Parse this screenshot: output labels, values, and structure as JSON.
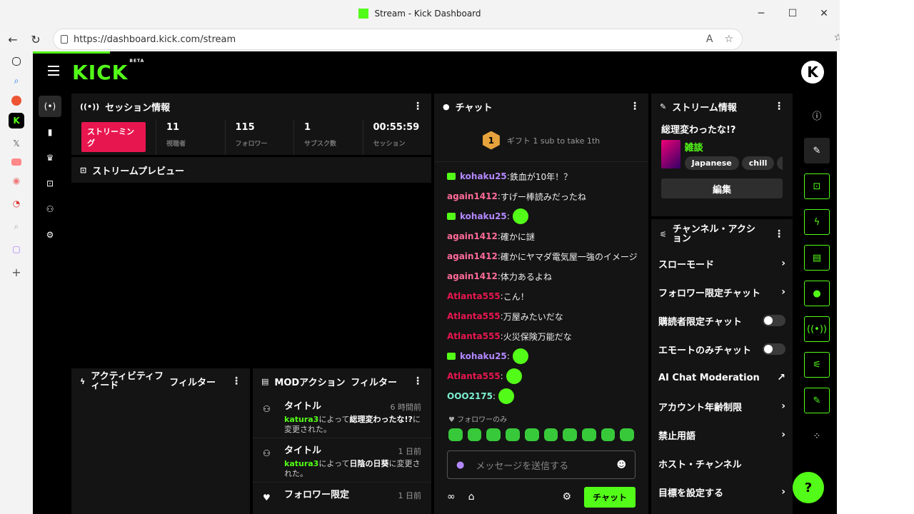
{
  "browser": {
    "title": "Stream - Kick Dashboard",
    "url": "https://dashboard.kick.com/stream",
    "minimize": "─",
    "maximize": "☐",
    "close": "✕"
  },
  "app": {
    "logo": "KICK",
    "logo_beta": "BETA",
    "colors": {
      "accent": "#53fc18",
      "live": "#e8164f",
      "panel": "#141414"
    }
  },
  "session": {
    "title": "セッション情報",
    "live_label": "ストリーミング",
    "stats": [
      {
        "value": "11",
        "label": "視聴者"
      },
      {
        "value": "115",
        "label": "フォロワー"
      },
      {
        "value": "1",
        "label": "サブスク数"
      },
      {
        "value": "00:55:59",
        "label": "セッション"
      }
    ]
  },
  "preview": {
    "title": "ストリームプレビュー"
  },
  "activity": {
    "title": "アクティビティフィード",
    "filter": "フィルター"
  },
  "mod": {
    "title": "MODアクション",
    "filter": "フィルター",
    "items": [
      {
        "title": "タイトル",
        "time": "6 時間前",
        "user": "katura3",
        "mid": "によって",
        "val": "総理変わったな!?",
        "end": "に変更された。"
      },
      {
        "title": "タイトル",
        "time": "1 日前",
        "user": "katura3",
        "mid": "によって",
        "val": "日陰の日葵",
        "end": "に変更された。"
      },
      {
        "title": "フォロワー限定",
        "time": "1 日前",
        "user": "",
        "mid": "",
        "val": "",
        "end": ""
      }
    ]
  },
  "chat": {
    "title": "チャット",
    "pinned": "ギフト 1 sub to take 1th",
    "pinned_rank": "1",
    "messages": [
      {
        "user": "kohaku25",
        "text": "鉄血が10年！？",
        "color": "#b388ff",
        "sub": true,
        "emote": false
      },
      {
        "user": "again1412",
        "text": "すげー棒読みだったね",
        "color": "#ff6b9a",
        "sub": false,
        "emote": false
      },
      {
        "user": "kohaku25",
        "text": "",
        "color": "#b388ff",
        "sub": true,
        "emote": true
      },
      {
        "user": "again1412",
        "text": "確かに謎",
        "color": "#ff6b9a",
        "sub": false,
        "emote": false
      },
      {
        "user": "again1412",
        "text": "確かにヤマダ電気屋一強のイメージ",
        "color": "#ff6b9a",
        "sub": false,
        "emote": false
      },
      {
        "user": "again1412",
        "text": "体力あるよね",
        "color": "#ff6b9a",
        "sub": false,
        "emote": false
      },
      {
        "user": "Atlanta555",
        "text": "こん！",
        "color": "#e8164f",
        "sub": false,
        "emote": false
      },
      {
        "user": "Atlanta555",
        "text": "万屋みたいだな",
        "color": "#e8164f",
        "sub": false,
        "emote": false
      },
      {
        "user": "Atlanta555",
        "text": "火災保険万能だな",
        "color": "#e8164f",
        "sub": false,
        "emote": false
      },
      {
        "user": "kohaku25",
        "text": "",
        "color": "#b388ff",
        "sub": true,
        "emote": true
      },
      {
        "user": "Atlanta555",
        "text": "",
        "color": "#e8164f",
        "sub": false,
        "emote": true
      },
      {
        "user": "OOO2175",
        "text": "",
        "color": "#7cf0d0",
        "sub": false,
        "emote": true
      }
    ],
    "follower_only": "フォロワーのみ",
    "input_placeholder": "メッセージを送信する",
    "send_label": "チャット"
  },
  "stream_info": {
    "title": "ストリーム情報",
    "stream_title": "総理変わったな!?",
    "category": "雑談",
    "tags": [
      "Japanese",
      "chill",
      "ga"
    ],
    "edit_label": "編集"
  },
  "channel_actions": {
    "title": "チャンネル・アクション",
    "items": [
      {
        "label": "スローモード",
        "type": "arrow"
      },
      {
        "label": "フォロワー限定チャット",
        "type": "arrow"
      },
      {
        "label": "購読者限定チャット",
        "type": "toggle"
      },
      {
        "label": "エモートのみチャット",
        "type": "toggle"
      },
      {
        "label": "AI Chat Moderation",
        "type": "external"
      },
      {
        "label": "アカウント年齢制限",
        "type": "arrow"
      },
      {
        "label": "禁止用語",
        "type": "arrow"
      },
      {
        "label": "ホスト・チャンネル",
        "type": "none"
      },
      {
        "label": "目標を設定する",
        "type": "arrow"
      }
    ]
  }
}
